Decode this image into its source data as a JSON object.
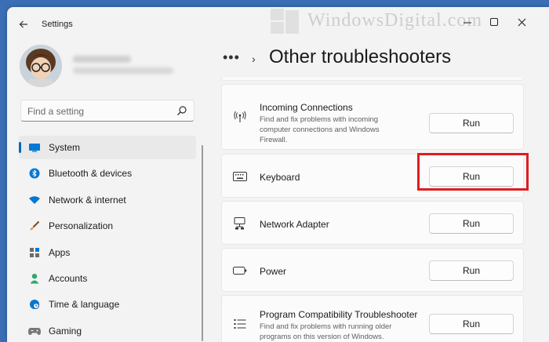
{
  "window": {
    "app_title": "Settings",
    "back_icon": "arrow-left-icon",
    "watermark": "WindowsDigital.com",
    "controls": [
      "minimize-icon",
      "maximize-icon",
      "close-icon"
    ]
  },
  "sidebar": {
    "search": {
      "placeholder": "Find a setting",
      "value": ""
    },
    "items": [
      {
        "label": "System",
        "icon": "monitor-icon",
        "color": "#0078d4",
        "active": true
      },
      {
        "label": "Bluetooth & devices",
        "icon": "bluetooth-icon",
        "color": "#0078d4"
      },
      {
        "label": "Network & internet",
        "icon": "wifi-icon",
        "color": "#0078d4"
      },
      {
        "label": "Personalization",
        "icon": "brush-icon",
        "color": "#e8912d"
      },
      {
        "label": "Apps",
        "icon": "apps-icon",
        "color": "#6b6b6b"
      },
      {
        "label": "Accounts",
        "icon": "person-icon",
        "color": "#2ea86b"
      },
      {
        "label": "Time & language",
        "icon": "globe-clock-icon",
        "color": "#0078d4"
      },
      {
        "label": "Gaming",
        "icon": "gamepad-icon",
        "color": "#777777"
      }
    ]
  },
  "main": {
    "breadcrumb_more": "•••",
    "breadcrumb_separator": "›",
    "title": "Other troubleshooters",
    "troubleshooters": [
      {
        "title": "Incoming Connections",
        "description": "Find and fix problems with incoming computer connections and Windows Firewall.",
        "icon": "antenna-icon",
        "button": "Run"
      },
      {
        "title": "Keyboard",
        "description": "",
        "icon": "keyboard-icon",
        "button": "Run",
        "highlighted": true
      },
      {
        "title": "Network Adapter",
        "description": "",
        "icon": "network-pc-icon",
        "button": "Run"
      },
      {
        "title": "Power",
        "description": "",
        "icon": "battery-icon",
        "button": "Run"
      },
      {
        "title": "Program Compatibility Troubleshooter",
        "description": "Find and fix problems with running older programs on this version of Windows.",
        "icon": "list-icon",
        "button": "Run"
      }
    ]
  },
  "colors": {
    "accent": "#0067c0",
    "highlight": "#e21b1b"
  }
}
